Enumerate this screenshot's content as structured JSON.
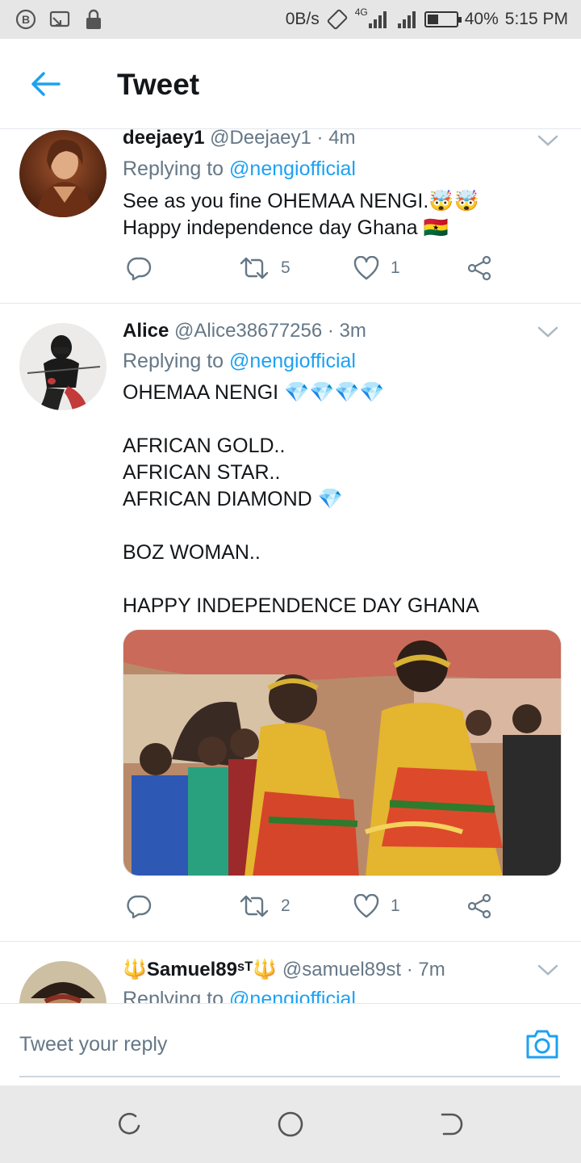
{
  "statusbar": {
    "net_speed": "0B/s",
    "net_type": "4G",
    "battery": "40%",
    "battery_level": 0.4,
    "time": "5:15 PM"
  },
  "header": {
    "title": "Tweet"
  },
  "tweets": [
    {
      "name": "deejaey1",
      "handle": "@Deejaey1",
      "time": "· 4m",
      "replying_prefix": "Replying to ",
      "replying_to": "@nengiofficial",
      "text": "See as you fine OHEMAA NENGI.🤯🤯\nHappy independence day Ghana 🇬🇭",
      "retweets": "5",
      "likes": "1"
    },
    {
      "name": "Alice",
      "handle": "@Alice38677256",
      "time": "· 3m",
      "replying_prefix": "Replying to ",
      "replying_to": "@nengiofficial",
      "text": "OHEMAA NENGI 💎💎💎💎\n\nAFRICAN GOLD..\nAFRICAN STAR..\nAFRICAN DIAMOND 💎\n\nBOZ WOMAN..\n\nHAPPY INDEPENDENCE DAY GHANA",
      "retweets": "2",
      "likes": "1"
    },
    {
      "name": "🔱Samuel89ˢᵀ🔱",
      "handle": "@samuel89st",
      "time": "· 7m",
      "replying_prefix": "Replying to ",
      "replying_to": "@nengiofficial"
    }
  ],
  "reply": {
    "placeholder": "Tweet your reply"
  },
  "colors": {
    "accent": "#1da1f2",
    "secondary_text": "#657786",
    "divider": "#e1e8ed"
  },
  "icons": [
    "back-arrow-icon",
    "reply-icon",
    "retweet-icon",
    "like-icon",
    "share-icon",
    "chevron-down-icon",
    "camera-icon"
  ]
}
